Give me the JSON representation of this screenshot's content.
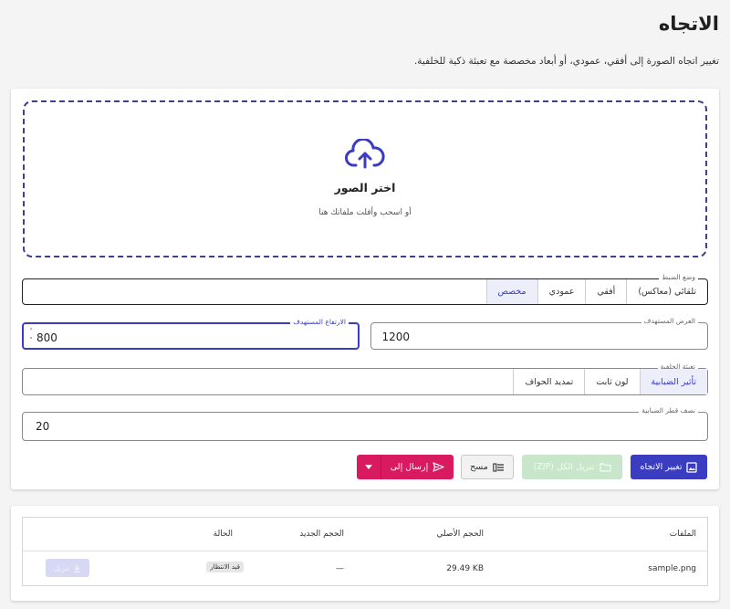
{
  "page": {
    "title": "الاتجاه",
    "description": "تغيير اتجاه الصورة إلى أفقي، عمودي، أو أبعاد مخصصة مع تعبئة ذكية للخلفية."
  },
  "dropzone": {
    "icon": "cloud-upload-icon",
    "title": "اختر الصور",
    "subtitle": "أو اسحب وأفلت ملفاتك هنا"
  },
  "mode": {
    "legend": "وضع الضبط",
    "options": [
      "تلقائي (معاكس)",
      "أفقي",
      "عمودي",
      "مخصص"
    ],
    "selected": "مخصص"
  },
  "target_width": {
    "label": "العرض المستهدف",
    "value": "1200"
  },
  "target_height": {
    "label": "الارتفاع المستهدف",
    "value": "800"
  },
  "fill": {
    "legend": "تعبئة الخلفية",
    "options": [
      "تأثير الضبابية",
      "لون ثابت",
      "تمديد الحواف"
    ],
    "selected": "تأثير الضبابية"
  },
  "blur_radius": {
    "label": "نصف قطر الضبابية",
    "value": "20"
  },
  "actions": {
    "orient_label": "تغيير الاتجاه",
    "zip_label": "تنزيل الكل (ZIP)",
    "clear_label": "مسح",
    "send_label": "إرسال إلى"
  },
  "files_table": {
    "headers": {
      "files": "الملفات",
      "original_size": "الحجم الأصلي",
      "new_size": "الحجم الجديد",
      "status": "الحالة"
    },
    "rows": [
      {
        "name": "sample.png",
        "original_size": "29.49 KB",
        "new_size": "—",
        "status": "قيد الانتظار",
        "download_label": "تنزيل"
      }
    ]
  },
  "colors": {
    "primary": "#3a3dbf",
    "send": "#d81b60",
    "zip_disabled": "#c8e6c9",
    "download_disabled": "#d7d8f3"
  }
}
